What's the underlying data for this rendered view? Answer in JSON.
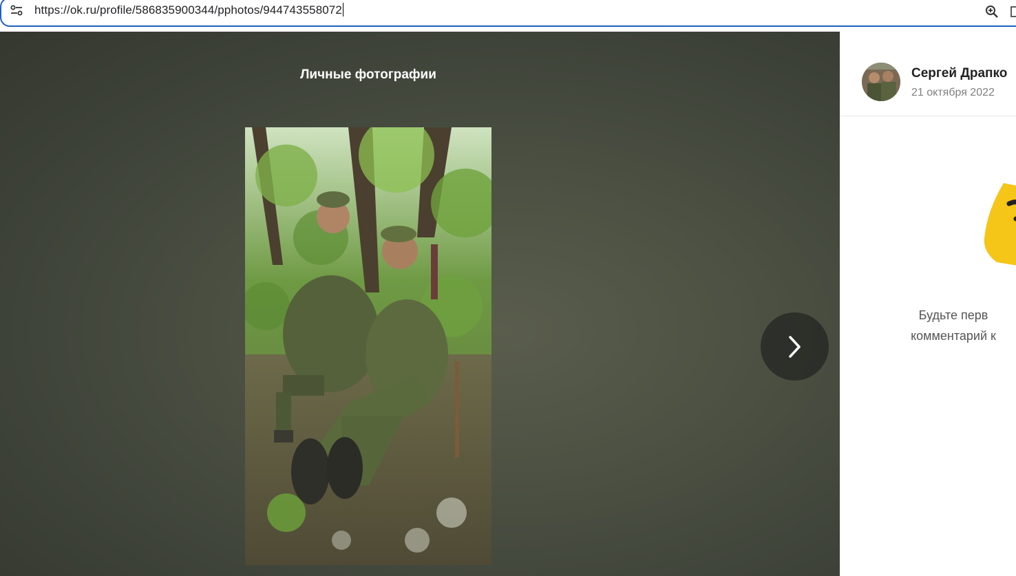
{
  "browser": {
    "url": "https://ok.ru/profile/586835900344/pphotos/944743558072",
    "site_info_icon": "tune-icon",
    "zoom_icon": "zoom-in-icon",
    "bookmark_icon": "bookmark-icon"
  },
  "viewer": {
    "album_title": "Личные фотографии",
    "photo_description": "photo-of-two-soldiers-in-forest",
    "next_icon": "chevron-right-icon"
  },
  "sidebar": {
    "author_name": "Сергей Драпко",
    "date": "21 октября 2022",
    "empty_comments_line1": "Будьте перв",
    "empty_comments_line2": "комментарий к"
  },
  "colors": {
    "accent_focus": "#1f5fbf",
    "viewer_bg": "#484c40",
    "mascot_yellow": "#f5c518"
  }
}
